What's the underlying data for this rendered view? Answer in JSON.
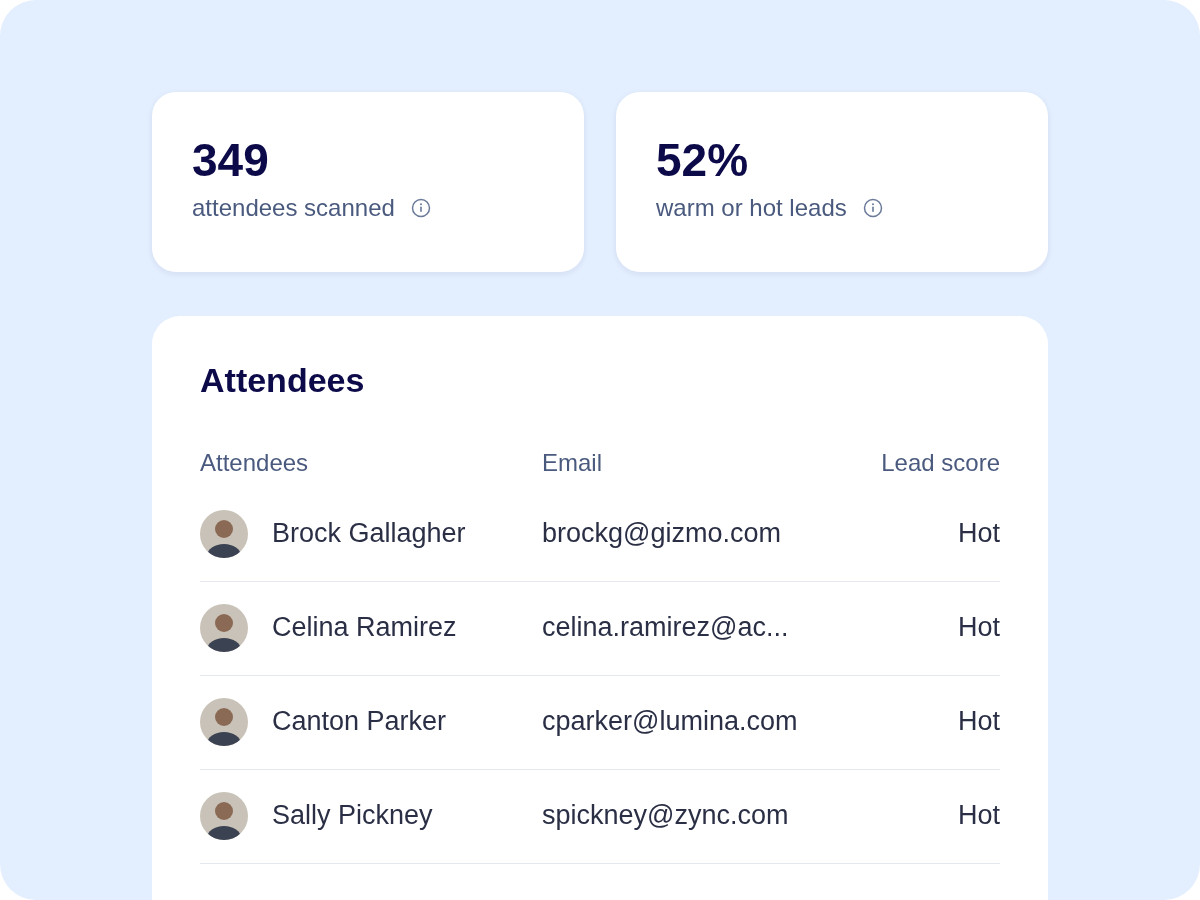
{
  "stats": [
    {
      "value": "349",
      "label": "attendees scanned"
    },
    {
      "value": "52%",
      "label": "warm or hot leads"
    }
  ],
  "table": {
    "title": "Attendees",
    "columns": [
      "Attendees",
      "Email",
      "Lead score"
    ],
    "rows": [
      {
        "name": "Brock Gallagher",
        "email": "brockg@gizmo.com",
        "score": "Hot"
      },
      {
        "name": "Celina Ramirez",
        "email": "celina.ramirez@ac...",
        "score": "Hot"
      },
      {
        "name": "Canton Parker",
        "email": "cparker@lumina.com",
        "score": "Hot"
      },
      {
        "name": "Sally Pickney",
        "email": "spickney@zync.com",
        "score": "Hot"
      }
    ]
  }
}
